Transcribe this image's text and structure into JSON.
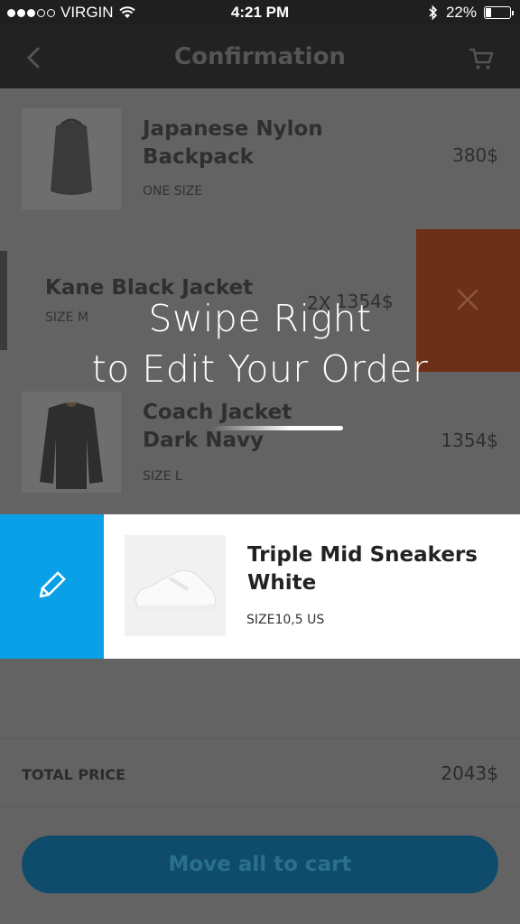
{
  "status_bar": {
    "carrier": "VIRGIN",
    "time": "4:21 PM",
    "battery": "22%",
    "battery_level": 0.22,
    "signal_dots_filled": 3,
    "signal_dots_total": 5
  },
  "nav": {
    "title": "Confirmation",
    "back_icon": "chevron-left-icon",
    "cart_icon": "cart-icon"
  },
  "items": [
    {
      "name_line1": "Japanese Nylon",
      "name_line2": "Backpack",
      "size": "ONE SIZE",
      "price": "380$"
    },
    {
      "name_line1": "Kane Black Jacket",
      "name_line2": "",
      "size": "SIZE M",
      "quantity": "2X",
      "price": "1354$"
    },
    {
      "name_line1": "Coach Jacket",
      "name_line2": "Dark Navy",
      "size": "SIZE L",
      "price": "1354$"
    },
    {
      "name_line1": "Triple Mid Sneakers",
      "name_line2": "White",
      "size": "SIZE10,5 US"
    }
  ],
  "overlay": {
    "line1": "Swipe Right",
    "line2": "to Edit Your Order"
  },
  "total": {
    "label": "TOTAL PRICE",
    "value": "2043$"
  },
  "cta": {
    "label": "Move all to cart"
  },
  "colors": {
    "edit_accent": "#0aa0e8",
    "delete_accent": "#6b3017",
    "cta_background": "#0f4c6b"
  }
}
